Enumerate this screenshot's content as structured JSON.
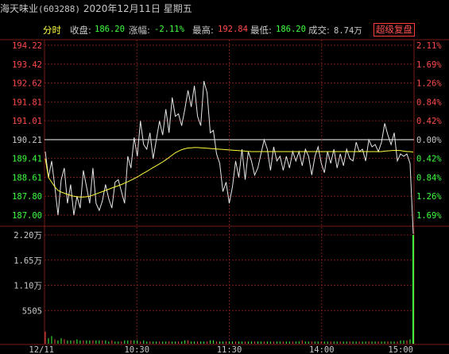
{
  "header": {
    "stock_name": "海天味业",
    "stock_code": "(603288)",
    "date": "2020年12月11日",
    "weekday": "星期五"
  },
  "info_bar": {
    "mode_label": "分时",
    "close_label": "收盘:",
    "close_value": "186.20",
    "change_label": "涨幅:",
    "change_value": "-2.11%",
    "high_label": "最高:",
    "high_value": "192.84",
    "low_label": "最低:",
    "low_value": "186.20",
    "volume_label": "成交:",
    "volume_value": "8.74万",
    "super_button": "超级复盘"
  },
  "colors": {
    "up": "#ff4a4a",
    "down": "#40ff40",
    "price_line": "#e6e6e6",
    "avg_line": "#ffff40",
    "grid": "#7a1a1a",
    "neutral": "#c8c8c8"
  },
  "chart_data": {
    "type": "line",
    "price_axis_left": [
      "194.22",
      "193.42",
      "192.62",
      "191.81",
      "191.01",
      "190.21",
      "189.41",
      "188.61",
      "187.80",
      "187.00"
    ],
    "percent_axis_right": [
      "2.11%",
      "1.69%",
      "1.26%",
      "0.84%",
      "0.42%",
      "0.00%",
      "0.42%",
      "0.84%",
      "1.26%",
      "1.69%"
    ],
    "prev_close": 190.21,
    "ylim": [
      187.0,
      194.22
    ],
    "volume_axis": [
      "2.20万",
      "1.65万",
      "1.10万",
      "5505"
    ],
    "x_ticks": [
      "12/11",
      "10:30",
      "11:30",
      "14:00",
      "15:00"
    ],
    "series": [
      {
        "values": [
          189.7,
          188.6,
          189.3,
          188.2,
          187.0,
          188.5,
          189.0,
          187.5,
          188.3,
          187.0,
          187.8,
          187.3,
          188.9,
          188.2,
          187.5,
          189.0,
          187.5,
          187.2,
          187.6,
          188.3,
          187.7,
          187.3,
          188.4,
          188.5,
          188.0,
          187.5,
          189.5,
          189.0,
          190.3,
          189.5,
          191.0,
          190.0,
          189.8,
          190.5,
          189.4,
          190.2,
          191.0,
          190.4,
          191.5,
          190.5,
          192.0,
          191.2,
          191.3,
          190.8,
          191.5,
          192.3,
          191.6,
          192.5,
          191.2,
          190.8,
          192.7,
          192.2,
          190.5,
          190.6,
          189.6,
          189.2,
          188.0,
          188.4,
          187.5,
          188.2,
          189.3,
          188.6,
          189.8,
          188.5,
          189.7,
          189.3,
          188.7,
          189.0,
          189.6,
          190.2,
          189.8,
          188.9,
          189.9,
          189.3,
          189.5,
          188.9,
          189.5,
          189.0,
          189.7,
          189.3,
          189.7,
          189.1,
          189.8,
          189.5,
          188.7,
          189.5,
          189.9,
          189.2,
          188.8,
          189.7,
          189.2,
          189.8,
          189.0,
          189.6,
          189.1,
          189.8,
          189.4,
          189.3,
          190.1,
          189.7,
          189.8,
          189.3,
          190.2,
          189.9,
          190.0,
          189.7,
          190.1,
          190.9,
          190.4,
          190.0,
          190.5,
          189.3,
          189.6,
          189.5,
          189.6,
          189.2,
          186.2
        ],
        "color": "#e6e6e6"
      },
      {
        "values": [
          189.4,
          188.6,
          188.4,
          188.2,
          188.05,
          187.98,
          187.93,
          187.88,
          187.84,
          187.8,
          187.78,
          187.77,
          187.77,
          187.78,
          187.8,
          187.85,
          187.9,
          187.95,
          188.0,
          188.05,
          188.1,
          188.15,
          188.2,
          188.25,
          188.3,
          188.36,
          188.42,
          188.48,
          188.55,
          188.62,
          188.7,
          188.78,
          188.86,
          188.94,
          189.02,
          189.1,
          189.18,
          189.26,
          189.35,
          189.45,
          189.55,
          189.65,
          189.72,
          189.78,
          189.82,
          189.85,
          189.86,
          189.87,
          189.87,
          189.86,
          189.85,
          189.84,
          189.83,
          189.82,
          189.81,
          189.8,
          189.79,
          189.78,
          189.77,
          189.76,
          189.75,
          189.74,
          189.73,
          189.72,
          189.71,
          189.7,
          189.7,
          189.7,
          189.7,
          189.7,
          189.7,
          189.7,
          189.7,
          189.7,
          189.7,
          189.7,
          189.7,
          189.7,
          189.7,
          189.7,
          189.7,
          189.7,
          189.7,
          189.7,
          189.7,
          189.7,
          189.7,
          189.7,
          189.7,
          189.7,
          189.7,
          189.7,
          189.7,
          189.7,
          189.7,
          189.7,
          189.7,
          189.7,
          189.7,
          189.7,
          189.7,
          189.7,
          189.7,
          189.7,
          189.7,
          189.7,
          189.7,
          189.72,
          189.73,
          189.74,
          189.75,
          189.75,
          189.74,
          189.72,
          189.7,
          189.7,
          189.68
        ],
        "color": "#ffff40"
      }
    ],
    "volume": [
      0.11,
      0.05,
      0.07,
      0.04,
      0.03,
      0.05,
      0.04,
      0.03,
      0.03,
      0.03,
      0.04,
      0.03,
      0.03,
      0.03,
      0.03,
      0.03,
      0.03,
      0.03,
      0.03,
      0.03,
      0.02,
      0.03,
      0.02,
      0.02,
      0.02,
      0.03,
      0.03,
      0.03,
      0.03,
      0.03,
      0.02,
      0.03,
      0.02,
      0.02,
      0.02,
      0.02,
      0.02,
      0.02,
      0.02,
      0.02,
      0.02,
      0.02,
      0.02,
      0.02,
      0.03,
      0.03,
      0.02,
      0.02,
      0.02,
      0.02,
      0.02,
      0.02,
      0.03,
      0.03,
      0.02,
      0.02,
      0.02,
      0.02,
      0.02,
      0.02,
      0.02,
      0.02,
      0.02,
      0.02,
      0.02,
      0.02,
      0.02,
      0.02,
      0.02,
      0.02,
      0.02,
      0.02,
      0.02,
      0.02,
      0.02,
      0.02,
      0.02,
      0.02,
      0.02,
      0.02,
      0.02,
      0.03,
      0.02,
      0.02,
      0.02,
      0.02,
      0.02,
      0.02,
      0.02,
      0.02,
      0.02,
      0.02,
      0.02,
      0.02,
      0.02,
      0.02,
      0.02,
      0.02,
      0.02,
      0.02,
      0.02,
      0.02,
      0.02,
      0.02,
      0.02,
      0.02,
      0.02,
      0.02,
      0.02,
      0.02,
      0.02,
      0.02,
      0.03,
      0.03,
      0.03,
      0.04,
      1.0
    ]
  }
}
